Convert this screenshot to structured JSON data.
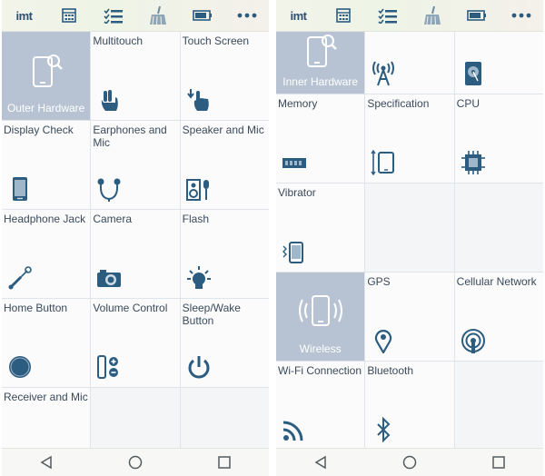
{
  "colors": {
    "icon": "#2c5c7f",
    "feature_tile": "#b7c3d3",
    "navbar_icon": "#555a5e"
  },
  "toolbar": {
    "logo": "imt",
    "icons": [
      "calculator-icon",
      "checklist-icon",
      "broom-icon",
      "battery-icon",
      "more-icon"
    ]
  },
  "left_panel": {
    "tiles": [
      {
        "label": "Outer Hardware",
        "icon": "phone-search-icon",
        "feature": true
      },
      {
        "label": "Multitouch",
        "icon": "two-finger-touch-icon"
      },
      {
        "label": "Touch Screen",
        "icon": "finger-touch-icon"
      },
      {
        "label": "Display Check",
        "icon": "phone-screen-icon"
      },
      {
        "label": "Earphones and Mic",
        "icon": "earphones-icon"
      },
      {
        "label": "Speaker and Mic",
        "icon": "speaker-mic-icon"
      },
      {
        "label": "Headphone Jack",
        "icon": "headphone-jack-icon"
      },
      {
        "label": "Camera",
        "icon": "camera-icon"
      },
      {
        "label": "Flash",
        "icon": "flash-bulb-icon"
      },
      {
        "label": "Home Button",
        "icon": "home-circle-icon"
      },
      {
        "label": "Volume Control",
        "icon": "volume-control-icon"
      },
      {
        "label": "Sleep/Wake Button",
        "icon": "power-icon"
      },
      {
        "label": "Receiver and Mic",
        "icon": "receiver-icon"
      }
    ]
  },
  "right_panel": {
    "tiles": [
      {
        "label": "Inner Hardware",
        "icon": "phone-search-icon",
        "feature": true
      },
      {
        "label": "",
        "icon": "antenna-icon"
      },
      {
        "label": "",
        "icon": "hard-drive-icon"
      },
      {
        "label": "Memory",
        "icon": "memory-icon"
      },
      {
        "label": "Specification",
        "icon": "phone-dimensions-icon"
      },
      {
        "label": "CPU",
        "icon": "cpu-icon"
      },
      {
        "label": "Vibrator",
        "icon": "vibrate-icon"
      },
      {
        "label": "Wireless",
        "icon": "wireless-phone-icon",
        "feature": true
      },
      {
        "label": "GPS",
        "icon": "location-pin-icon"
      },
      {
        "label": "Cellular Network",
        "icon": "cellular-signal-icon"
      },
      {
        "label": "Wi-Fi Connection",
        "icon": "wifi-icon"
      },
      {
        "label": "Bluetooth",
        "icon": "bluetooth-icon"
      }
    ]
  },
  "navbar": {
    "icons": [
      "back-icon",
      "home-icon",
      "recents-icon"
    ]
  }
}
